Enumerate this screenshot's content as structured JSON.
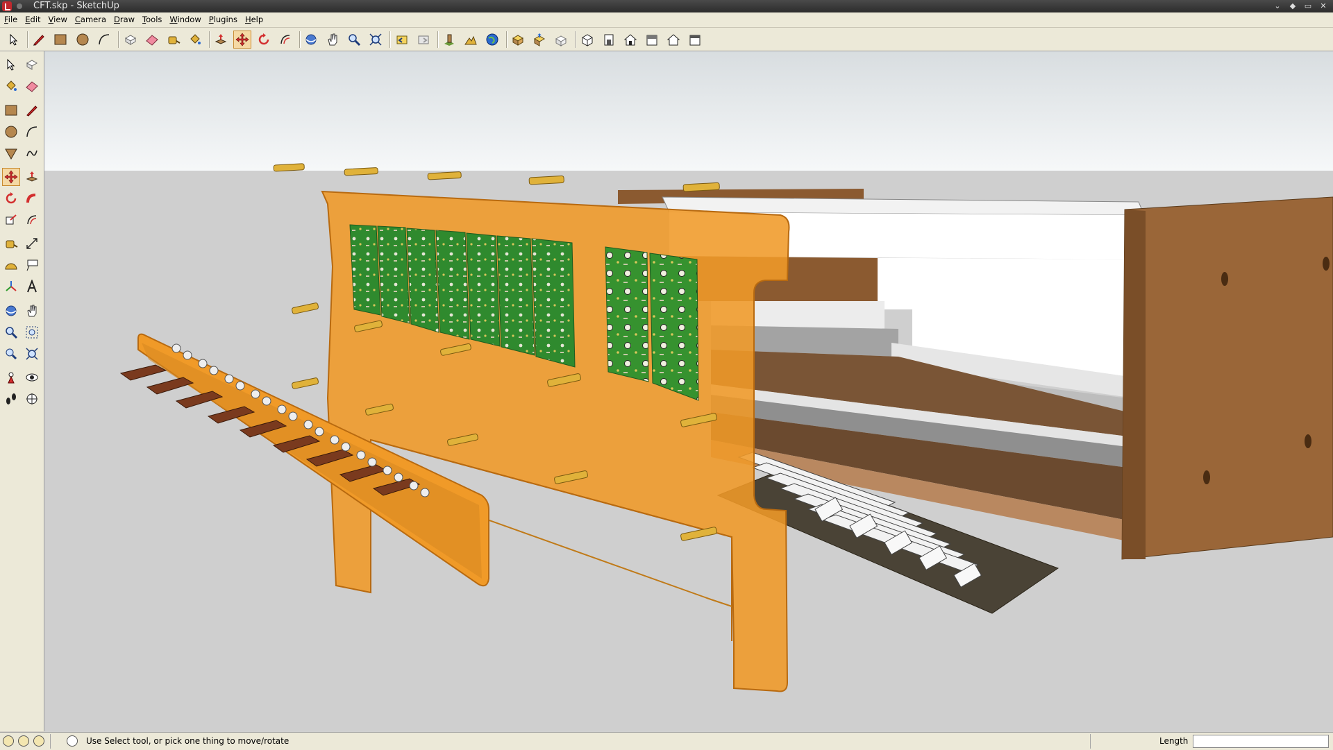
{
  "window": {
    "title": "CFT.skp - SketchUp",
    "controls": [
      "⌄",
      "◆",
      "▭",
      "✕"
    ]
  },
  "menu": [
    "File",
    "Edit",
    "View",
    "Camera",
    "Draw",
    "Tools",
    "Window",
    "Plugins",
    "Help"
  ],
  "toolbar": {
    "icons": [
      "select-icon",
      "pencil-icon",
      "rectangle-icon",
      "circle-icon",
      "arc-icon",
      "make-component-icon",
      "eraser-icon",
      "tape-measure-icon",
      "paint-bucket-icon",
      "push-pull-icon",
      "move-icon",
      "rotate-icon",
      "offset-icon",
      "orbit-icon",
      "pan-icon",
      "zoom-icon",
      "zoom-extents-icon",
      "previous-view-icon",
      "next-view-icon",
      "add-location-icon",
      "toggle-terrain-icon",
      "google-earth-icon",
      "get-models-icon",
      "share-model-icon",
      "share-component-icon",
      "iso-view-icon",
      "front-view-icon",
      "back-view-icon",
      "right-view-icon",
      "left-view-icon",
      "top-view-icon"
    ],
    "active": "move-icon"
  },
  "left_toolbar": {
    "icons": [
      "select-icon",
      "make-component-icon",
      "paint-bucket-icon",
      "eraser-icon",
      "rectangle-icon",
      "line-icon",
      "circle-icon",
      "arc-icon",
      "polygon-icon",
      "freehand-icon",
      "move-icon",
      "push-pull-icon",
      "rotate-icon",
      "follow-me-icon",
      "scale-icon",
      "offset-icon",
      "tape-measure-icon",
      "dimension-icon",
      "protractor-icon",
      "text-icon",
      "axes-icon",
      "3d-text-icon",
      "orbit-icon",
      "pan-icon",
      "zoom-icon",
      "zoom-window-icon",
      "previous-view-icon",
      "zoom-extents-icon",
      "position-camera-icon",
      "look-around-icon",
      "walk-icon",
      "section-plane-icon"
    ],
    "active": "move-icon"
  },
  "status": {
    "hint": "Use Select tool, or pick one thing to move/rotate",
    "measurement_label": "Length",
    "measurement_value": ""
  },
  "colors": {
    "sky_top": "#d8dde0",
    "sky_bottom": "#f6f8f9",
    "ground": "#cfcfcf",
    "acrylic": "#f09a28",
    "pcb": "#2f8a2e",
    "wood": "#9a6638",
    "active_tool": "#f5d9a4"
  }
}
